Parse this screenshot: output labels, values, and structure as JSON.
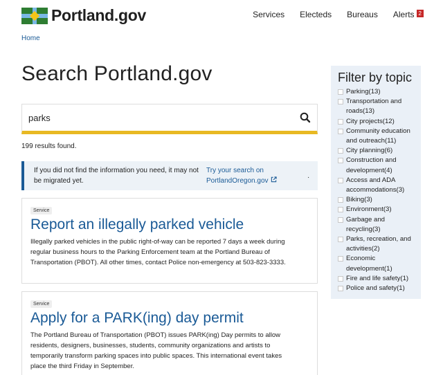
{
  "header": {
    "logo_text": "Portland.gov",
    "nav": [
      {
        "label": "Services"
      },
      {
        "label": "Electeds"
      },
      {
        "label": "Bureaus"
      },
      {
        "label": "Alerts",
        "badge": "2"
      }
    ]
  },
  "breadcrumb": {
    "home": "Home"
  },
  "page_title": "Search Portland.gov",
  "search": {
    "value": "parks",
    "icon": "search-icon"
  },
  "results_count": "199 results found.",
  "notice": {
    "text": "If you did not find the information you need, it may not be migrated yet.",
    "link_text": "Try your search on PortlandOregon.gov",
    "link_icon": "external-link-icon",
    "trailing": "."
  },
  "results": [
    {
      "tag": "Service",
      "title": "Report an illegally parked vehicle",
      "description": "Illegally parked vehicles in the public right-of-way can be reported 7 days a week during regular business hours to the Parking Enforcement team at the Portland Bureau of Transportation (PBOT). All other times, contact Police non-emergency at 503-823-3333."
    },
    {
      "tag": "Service",
      "title": "Apply for a PARK(ing) day permit",
      "description": "The Portland Bureau of Transportation (PBOT) issues PARK(ing) Day permits to allow residents, designers, businesses, students, community organizations and artists to temporarily transform parking spaces into public spaces. This international event takes place the third Friday in September."
    }
  ],
  "filter": {
    "title": "Filter by topic",
    "items": [
      {
        "label": "Parking(13)"
      },
      {
        "label": "Transportation and roads(13)"
      },
      {
        "label": "City projects(12)"
      },
      {
        "label": "Community education and outreach(11)"
      },
      {
        "label": "City planning(6)"
      },
      {
        "label": "Construction and development(4)"
      },
      {
        "label": "Access and ADA accommodations(3)"
      },
      {
        "label": "Biking(3)"
      },
      {
        "label": "Environment(3)"
      },
      {
        "label": "Garbage and recycling(3)"
      },
      {
        "label": "Parks, recreation, and activities(2)"
      },
      {
        "label": "Economic development(1)"
      },
      {
        "label": "Fire and life safety(1)"
      },
      {
        "label": "Police and safety(1)"
      }
    ]
  }
}
